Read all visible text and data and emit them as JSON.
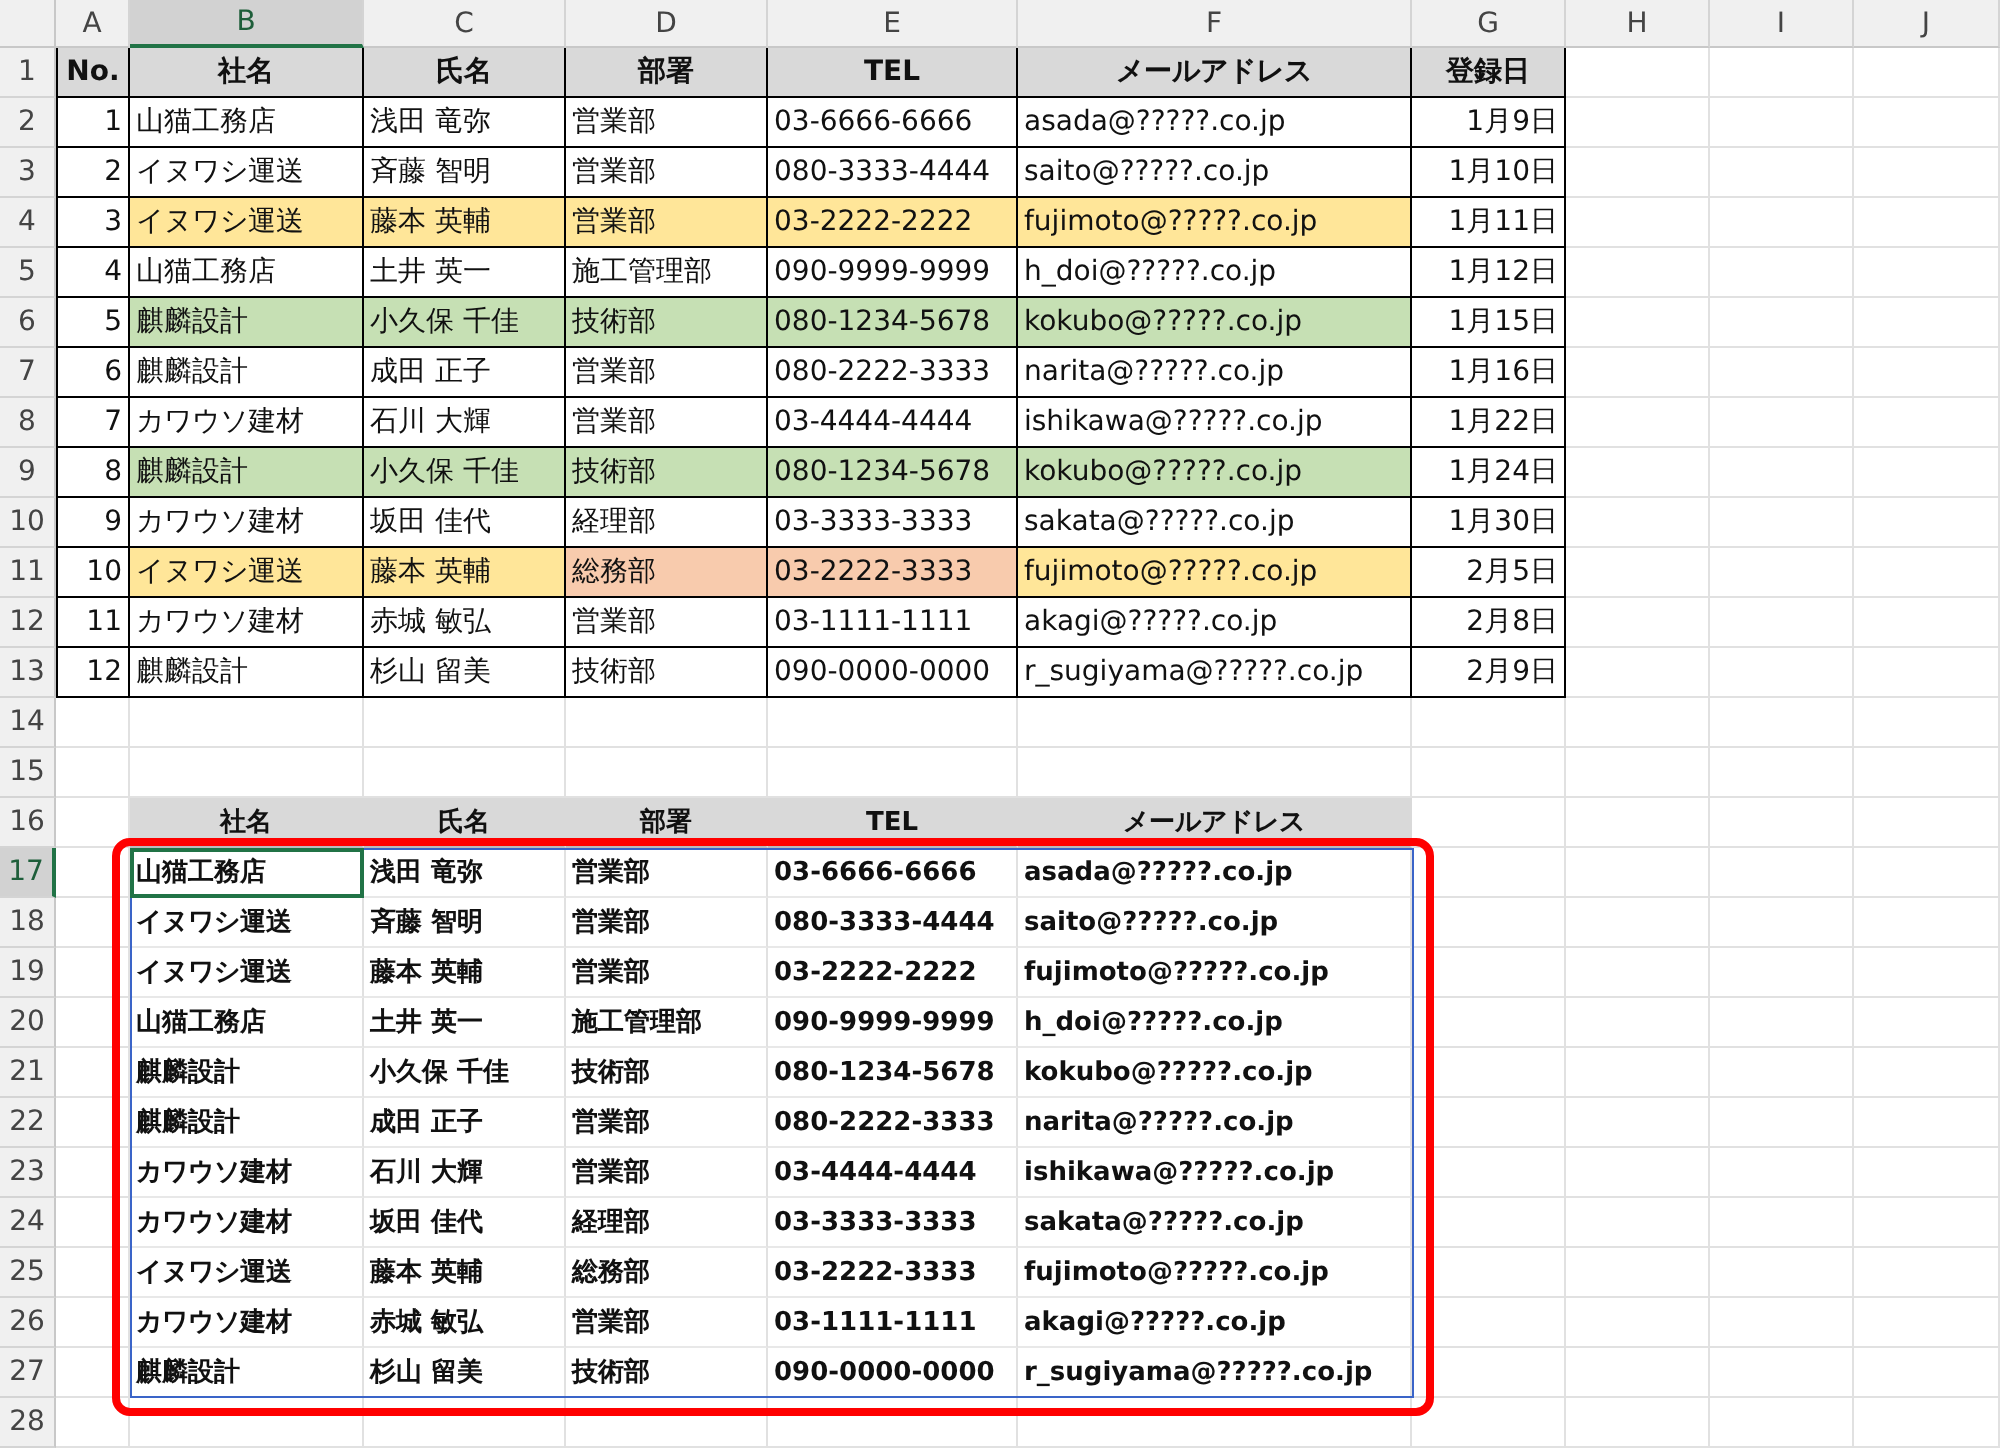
{
  "column_headers": [
    {
      "label": "A",
      "selected": false
    },
    {
      "label": "B",
      "selected": true
    },
    {
      "label": "C",
      "selected": false
    },
    {
      "label": "D",
      "selected": false
    },
    {
      "label": "E",
      "selected": false
    },
    {
      "label": "F",
      "selected": false
    },
    {
      "label": "G",
      "selected": false
    },
    {
      "label": "H",
      "selected": false
    },
    {
      "label": "I",
      "selected": false
    },
    {
      "label": "J",
      "selected": false
    }
  ],
  "row_numbers": [
    {
      "label": "1",
      "selected": false
    },
    {
      "label": "2",
      "selected": false
    },
    {
      "label": "3",
      "selected": false
    },
    {
      "label": "4",
      "selected": false
    },
    {
      "label": "5",
      "selected": false
    },
    {
      "label": "6",
      "selected": false
    },
    {
      "label": "7",
      "selected": false
    },
    {
      "label": "8",
      "selected": false
    },
    {
      "label": "9",
      "selected": false
    },
    {
      "label": "10",
      "selected": false
    },
    {
      "label": "11",
      "selected": false
    },
    {
      "label": "12",
      "selected": false
    },
    {
      "label": "13",
      "selected": false
    },
    {
      "label": "14",
      "selected": false
    },
    {
      "label": "15",
      "selected": false
    },
    {
      "label": "16",
      "selected": false
    },
    {
      "label": "17",
      "selected": true
    },
    {
      "label": "18",
      "selected": false
    },
    {
      "label": "19",
      "selected": false
    },
    {
      "label": "20",
      "selected": false
    },
    {
      "label": "21",
      "selected": false
    },
    {
      "label": "22",
      "selected": false
    },
    {
      "label": "23",
      "selected": false
    },
    {
      "label": "24",
      "selected": false
    },
    {
      "label": "25",
      "selected": false
    },
    {
      "label": "26",
      "selected": false
    },
    {
      "label": "27",
      "selected": false
    },
    {
      "label": "28",
      "selected": false
    }
  ],
  "source_table": {
    "columns": [
      "No.",
      "社名",
      "氏名",
      "部署",
      "TEL",
      "メールアドレス",
      "登録日"
    ],
    "rows": [
      {
        "cells": [
          {
            "text": "1"
          },
          {
            "text": "山猫工務店"
          },
          {
            "text": "浅田 竜弥"
          },
          {
            "text": "営業部"
          },
          {
            "text": "03-6666-6666"
          },
          {
            "text": "asada@?????.co.jp"
          },
          {
            "text": "1月9日"
          }
        ]
      },
      {
        "cells": [
          {
            "text": "2"
          },
          {
            "text": "イヌワシ運送"
          },
          {
            "text": "斉藤 智明"
          },
          {
            "text": "営業部"
          },
          {
            "text": "080-3333-4444"
          },
          {
            "text": "saito@?????.co.jp"
          },
          {
            "text": "1月10日"
          }
        ]
      },
      {
        "cells": [
          {
            "text": "3"
          },
          {
            "text": "イヌワシ運送",
            "color": "#ffe699"
          },
          {
            "text": "藤本 英輔",
            "color": "#ffe699"
          },
          {
            "text": "営業部",
            "color": "#ffe699"
          },
          {
            "text": "03-2222-2222",
            "color": "#ffe699"
          },
          {
            "text": "fujimoto@?????.co.jp",
            "color": "#ffe699"
          },
          {
            "text": "1月11日"
          }
        ]
      },
      {
        "cells": [
          {
            "text": "4"
          },
          {
            "text": "山猫工務店"
          },
          {
            "text": "土井 英一"
          },
          {
            "text": "施工管理部"
          },
          {
            "text": "090-9999-9999"
          },
          {
            "text": "h_doi@?????.co.jp"
          },
          {
            "text": "1月12日"
          }
        ]
      },
      {
        "cells": [
          {
            "text": "5"
          },
          {
            "text": "麒麟設計",
            "color": "#c6e0b4"
          },
          {
            "text": "小久保 千佳",
            "color": "#c6e0b4"
          },
          {
            "text": "技術部",
            "color": "#c6e0b4"
          },
          {
            "text": "080-1234-5678",
            "color": "#c6e0b4"
          },
          {
            "text": "kokubo@?????.co.jp",
            "color": "#c6e0b4"
          },
          {
            "text": "1月15日"
          }
        ]
      },
      {
        "cells": [
          {
            "text": "6"
          },
          {
            "text": "麒麟設計"
          },
          {
            "text": "成田 正子"
          },
          {
            "text": "営業部"
          },
          {
            "text": "080-2222-3333"
          },
          {
            "text": "narita@?????.co.jp"
          },
          {
            "text": "1月16日"
          }
        ]
      },
      {
        "cells": [
          {
            "text": "7"
          },
          {
            "text": "カワウソ建材"
          },
          {
            "text": "石川 大輝"
          },
          {
            "text": "営業部"
          },
          {
            "text": "03-4444-4444"
          },
          {
            "text": "ishikawa@?????.co.jp"
          },
          {
            "text": "1月22日"
          }
        ]
      },
      {
        "cells": [
          {
            "text": "8"
          },
          {
            "text": "麒麟設計",
            "color": "#c6e0b4"
          },
          {
            "text": "小久保 千佳",
            "color": "#c6e0b4"
          },
          {
            "text": "技術部",
            "color": "#c6e0b4"
          },
          {
            "text": "080-1234-5678",
            "color": "#c6e0b4"
          },
          {
            "text": "kokubo@?????.co.jp",
            "color": "#c6e0b4"
          },
          {
            "text": "1月24日"
          }
        ]
      },
      {
        "cells": [
          {
            "text": "9"
          },
          {
            "text": "カワウソ建材"
          },
          {
            "text": "坂田 佳代"
          },
          {
            "text": "経理部"
          },
          {
            "text": "03-3333-3333"
          },
          {
            "text": "sakata@?????.co.jp"
          },
          {
            "text": "1月30日"
          }
        ]
      },
      {
        "cells": [
          {
            "text": "10"
          },
          {
            "text": "イヌワシ運送",
            "color": "#ffe699"
          },
          {
            "text": "藤本 英輔",
            "color": "#ffe699"
          },
          {
            "text": "総務部",
            "color": "#f8cbad"
          },
          {
            "text": "03-2222-3333",
            "color": "#f8cbad"
          },
          {
            "text": "fujimoto@?????.co.jp",
            "color": "#ffe699"
          },
          {
            "text": "2月5日"
          }
        ]
      },
      {
        "cells": [
          {
            "text": "11"
          },
          {
            "text": "カワウソ建材"
          },
          {
            "text": "赤城 敏弘"
          },
          {
            "text": "営業部"
          },
          {
            "text": "03-1111-1111"
          },
          {
            "text": "akagi@?????.co.jp"
          },
          {
            "text": "2月8日"
          }
        ]
      },
      {
        "cells": [
          {
            "text": "12"
          },
          {
            "text": "麒麟設計"
          },
          {
            "text": "杉山 留美"
          },
          {
            "text": "技術部"
          },
          {
            "text": "090-0000-0000"
          },
          {
            "text": "r_sugiyama@?????.co.jp"
          },
          {
            "text": "2月9日"
          }
        ]
      }
    ]
  },
  "extract_table": {
    "columns": [
      "社名",
      "氏名",
      "部署",
      "TEL",
      "メールアドレス"
    ],
    "rows": [
      [
        "山猫工務店",
        "浅田 竜弥",
        "営業部",
        "03-6666-6666",
        "asada@?????.co.jp"
      ],
      [
        "イヌワシ運送",
        "斉藤 智明",
        "営業部",
        "080-3333-4444",
        "saito@?????.co.jp"
      ],
      [
        "イヌワシ運送",
        "藤本 英輔",
        "営業部",
        "03-2222-2222",
        "fujimoto@?????.co.jp"
      ],
      [
        "山猫工務店",
        "土井 英一",
        "施工管理部",
        "090-9999-9999",
        "h_doi@?????.co.jp"
      ],
      [
        "麒麟設計",
        "小久保 千佳",
        "技術部",
        "080-1234-5678",
        "kokubo@?????.co.jp"
      ],
      [
        "麒麟設計",
        "成田 正子",
        "営業部",
        "080-2222-3333",
        "narita@?????.co.jp"
      ],
      [
        "カワウソ建材",
        "石川 大輝",
        "営業部",
        "03-4444-4444",
        "ishikawa@?????.co.jp"
      ],
      [
        "カワウソ建材",
        "坂田 佳代",
        "経理部",
        "03-3333-3333",
        "sakata@?????.co.jp"
      ],
      [
        "イヌワシ運送",
        "藤本 英輔",
        "総務部",
        "03-2222-3333",
        "fujimoto@?????.co.jp"
      ],
      [
        "カワウソ建材",
        "赤城 敏弘",
        "営業部",
        "03-1111-1111",
        "akagi@?????.co.jp"
      ],
      [
        "麒麟設計",
        "杉山 留美",
        "技術部",
        "090-0000-0000",
        "r_sugiyama@?????.co.jp"
      ]
    ]
  }
}
